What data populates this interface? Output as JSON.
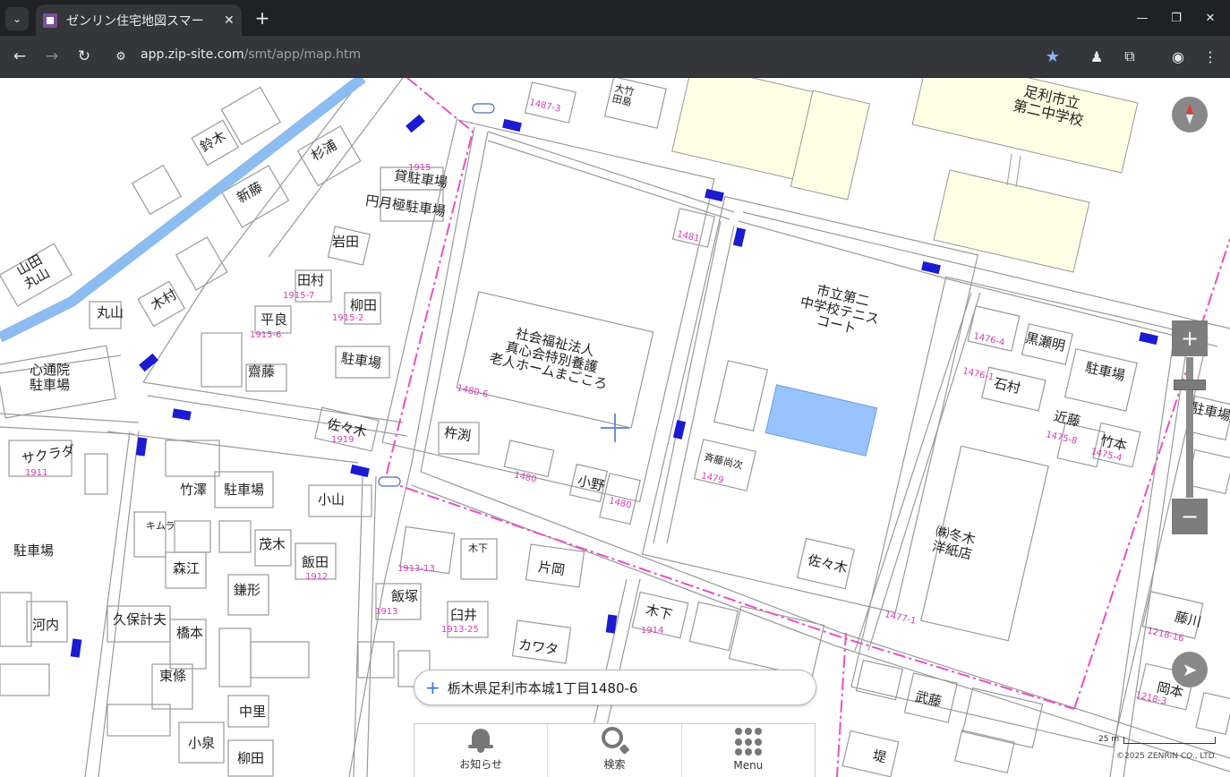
{
  "browser": {
    "tab_title": "ゼンリン住宅地図スマー",
    "url_domain": "app.zip-site.com",
    "url_path": "/smt/app/map.htm"
  },
  "map": {
    "address": "栃木県足利市本城1丁目1480-6",
    "scale_label": "25 m",
    "copyright": "©2025 ZENRIN CO., LTD.",
    "labels": {
      "school": "足利市立\n第二中学校",
      "tennis": "市立第二\n中学校テニス\nコート",
      "nursing_home": "社会福祉法人\n真心会特別養護\n老人ホームまごころ",
      "parking_top": "貸駐車場",
      "entsuki_parking": "円月極駐車場",
      "iwata": "岩田",
      "tamura": "田村",
      "yanagida": "柳田",
      "hirayoshi": "平良",
      "parking_mid": "駐車場",
      "shindoin": "心通院\n駐車場",
      "sasaki1": "佐々木",
      "kinebuchi": "杵渕",
      "ono": "小野",
      "saito": "斉藤尚次",
      "sasaki2": "佐々木",
      "fuyuki": "㈱冬木\n洋紙店",
      "ishimura": "石村",
      "kurosemei": "黒瀬明",
      "parking_right": "駐車場",
      "kondo": "近藤",
      "takemoto": "竹本",
      "parking_right2": "駐車場",
      "sakurada": "サクラダ",
      "takezawa": "竹澤",
      "parking_left": "駐車場",
      "koyama": "小山",
      "kimura": "キムラ",
      "morie": "森江",
      "shigeki": "茂木",
      "iida": "飯田",
      "kamagata": "鎌形",
      "parking_far_left": "駐車場",
      "kawauchi": "河内",
      "kubokeio": "久保計夫",
      "hashimoto": "橋本",
      "higashi": "東條",
      "nakazato": "中里",
      "koizumi": "小泉",
      "yanagida2": "柳田",
      "katayama": "片岡",
      "iizuka": "飯塚",
      "usui": "臼井",
      "kawata": "カワタ",
      "kinoshita": "木下",
      "kinoshita2": "木下",
      "fujikawa": "藤川",
      "okamoto": "岡本",
      "takeyasu": "武藤",
      "tsutsumi": "堤",
      "yamada_maruyama": "山田\n丸山",
      "maruyama": "丸山",
      "kimura2": "木村",
      "suzuki": "鈴木",
      "sugiura": "杉浦",
      "shinto": "新藤",
      "otake": "大竹\n田島",
      "saiko": "齋藤"
    },
    "numbers": {
      "n1480_6": "1480-6",
      "n1481": "1481",
      "n1480a": "1480",
      "n1480b": "1480",
      "n1479": "1479",
      "n1477_1": "1477-1",
      "n1476_1": "1476-1",
      "n1476_4": "1476-4",
      "n1475_8": "1475-8",
      "n1475_4": "1475-4",
      "n1915": "1915",
      "n1915_7": "1915-7",
      "n1915_2": "1915-2",
      "n1915_6": "1915-6",
      "n1919": "1919",
      "n1911": "1911",
      "n1912": "1912",
      "n1913": "1913",
      "n1913_13": "1913-13",
      "n1913_25": "1913-25",
      "n1914": "1914",
      "n1218_16": "1218-16",
      "n1218_3": "1218-3",
      "n1487_3": "1487-3"
    }
  },
  "controls": {
    "zoom_in": "+",
    "zoom_out": "−",
    "zoom_level": 0.17
  },
  "bottom_nav": {
    "notice": "お知らせ",
    "search": "検索",
    "menu": "Menu"
  }
}
